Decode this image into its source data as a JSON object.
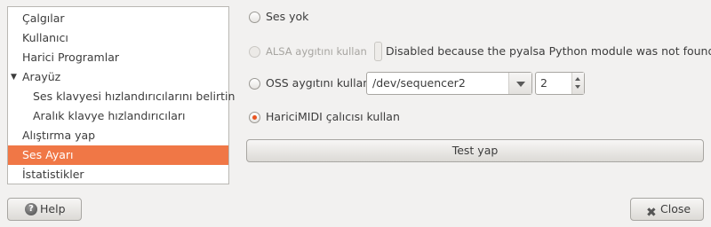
{
  "sidebar": {
    "items": [
      {
        "label": "Çalgılar"
      },
      {
        "label": "Kullanıcı"
      },
      {
        "label": "Harici Programlar"
      },
      {
        "label": "Arayüz",
        "expander": "▼"
      },
      {
        "label": "Ses klavyesi hızlandırıcılarını belirtin"
      },
      {
        "label": "Aralık klavye hızlandırıcıları"
      },
      {
        "label": "Alıştırma yap"
      },
      {
        "label": "Ses Ayarı"
      },
      {
        "label": "İstatistikler"
      }
    ]
  },
  "options": {
    "no_sound": "Ses yok",
    "alsa_label": "ALSA aygıtını kullan",
    "alsa_message": "Disabled because the pyalsa Python module was not found.",
    "oss_label": "OSS aygıtını kullan",
    "oss_device": "/dev/sequencer2",
    "oss_spin_value": "2",
    "external_midi": "HariciMIDI çalıcısı kullan"
  },
  "buttons": {
    "test": "Test yap",
    "help": "Help",
    "close": "Close"
  },
  "colors": {
    "accent": "#f07746",
    "radio_dot": "#e95420"
  }
}
